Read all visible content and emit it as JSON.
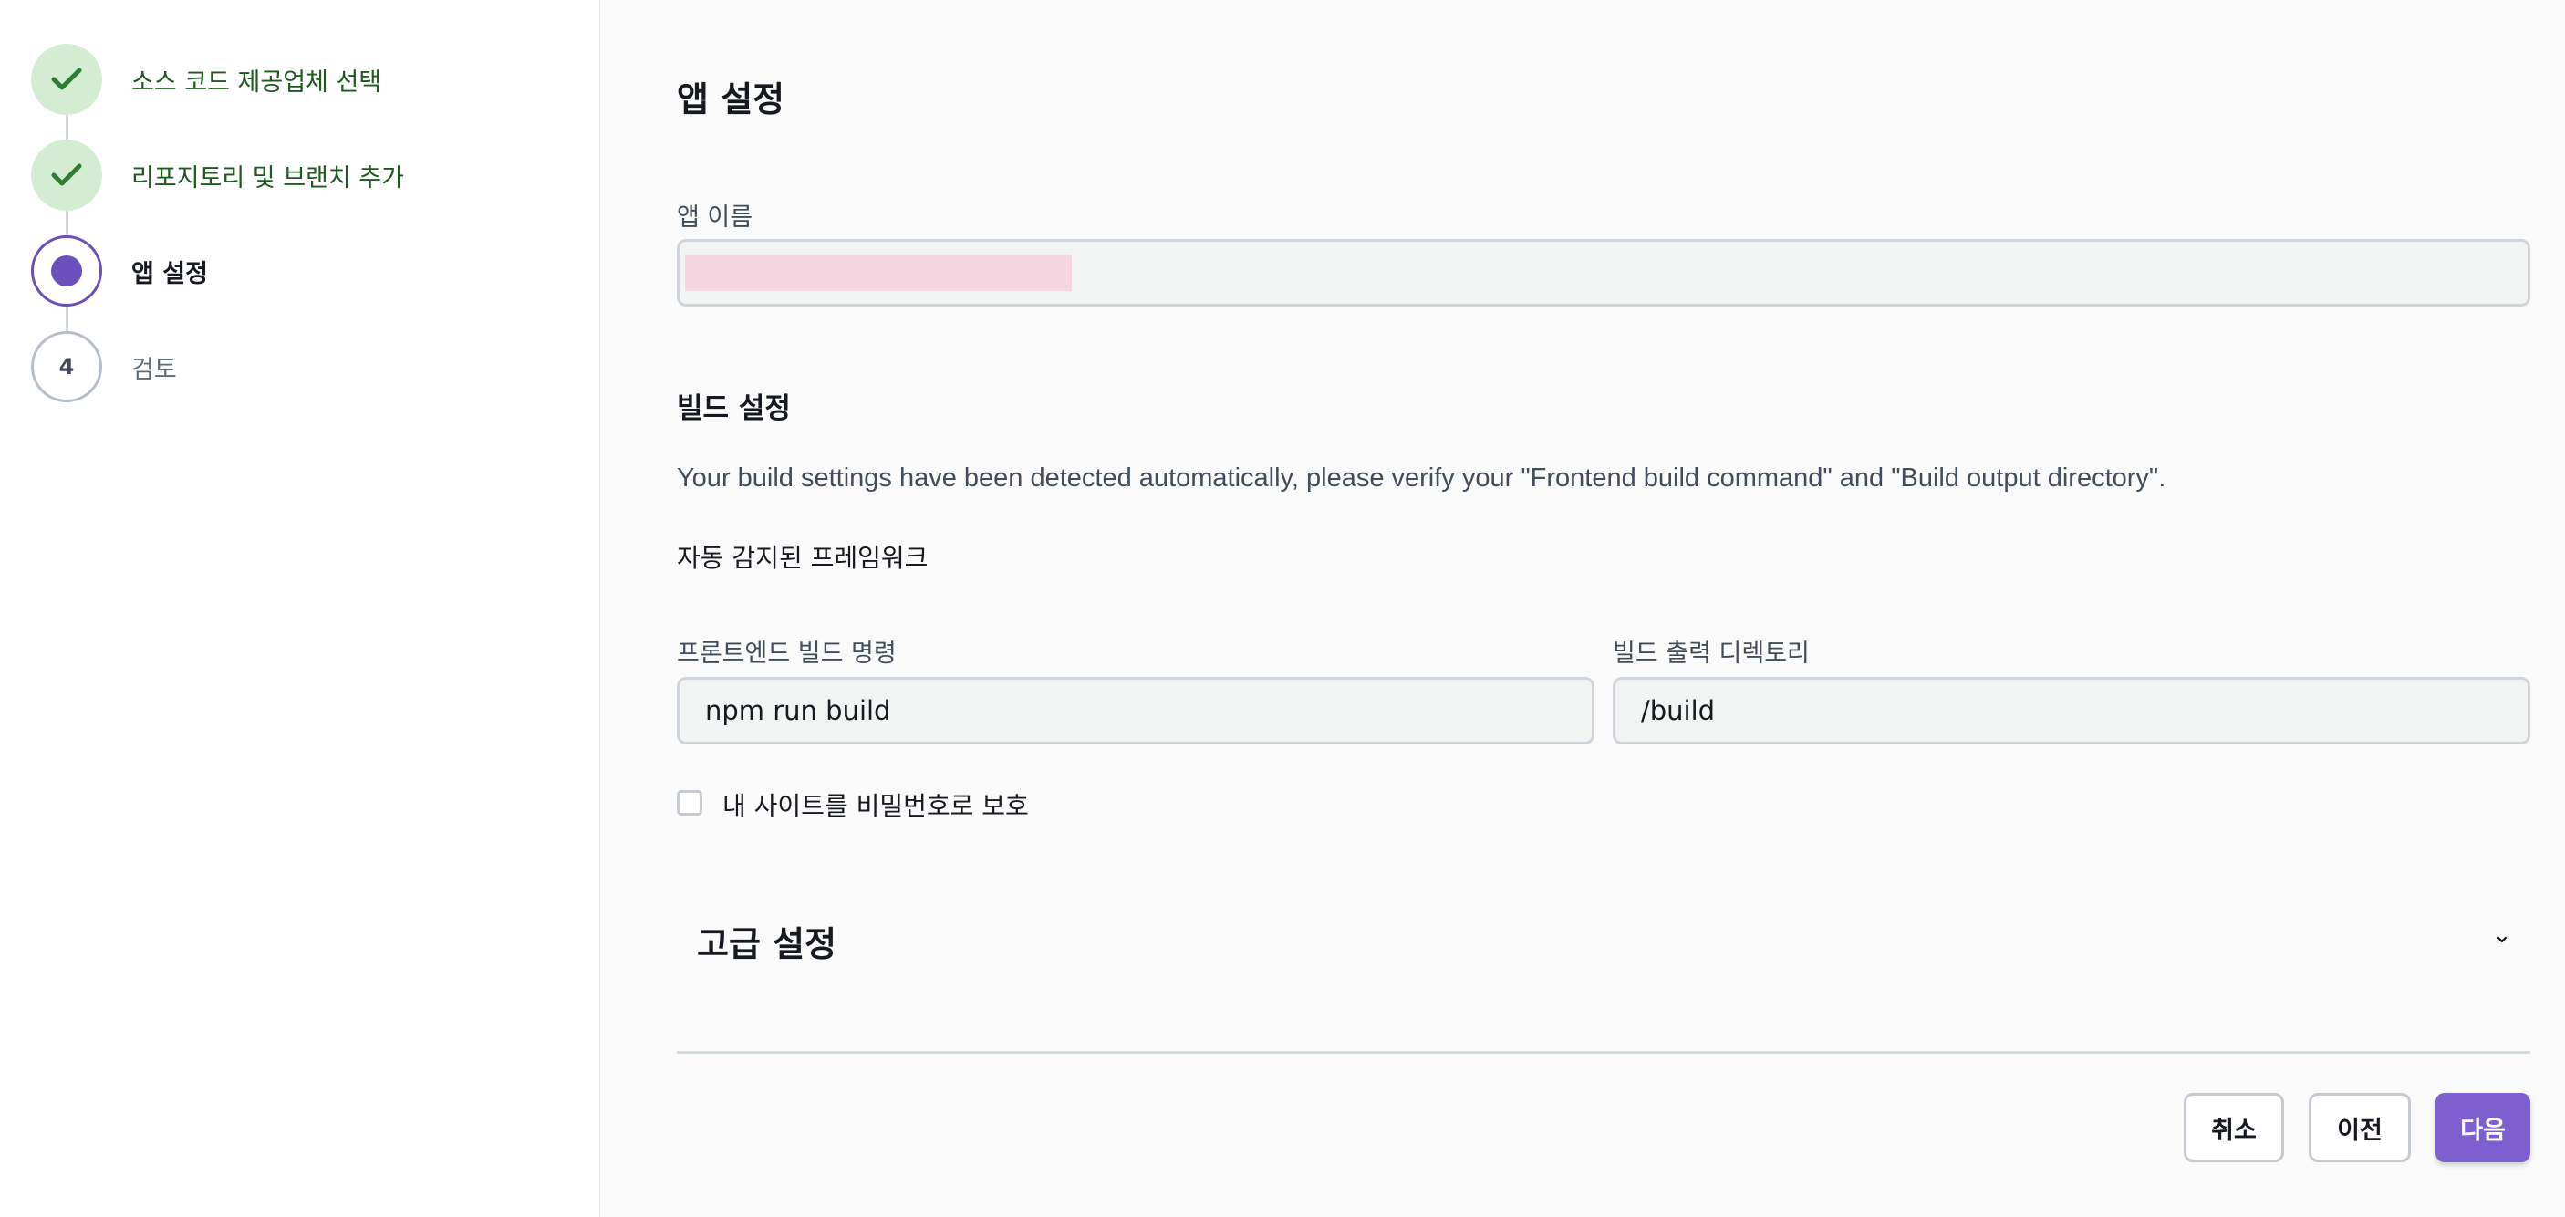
{
  "steps": [
    {
      "label": "소스 코드 제공업체 선택",
      "state": "done"
    },
    {
      "label": "리포지토리 및 브랜치 추가",
      "state": "done"
    },
    {
      "label": "앱 설정",
      "state": "current"
    },
    {
      "label": "검토",
      "state": "pending",
      "number": "4"
    }
  ],
  "main": {
    "title": "앱 설정",
    "app_name_label": "앱 이름",
    "app_name_value": "",
    "build_settings_title": "빌드 설정",
    "build_settings_desc": "Your build settings have been detected automatically, please verify your \"Frontend build command\" and \"Build output directory\".",
    "framework_label": "자동 감지된 프레임워크",
    "build_command_label": "프론트엔드 빌드 명령",
    "build_command_value": "npm run build",
    "output_dir_label": "빌드 출력 디렉토리",
    "output_dir_value": "/build",
    "password_protect_label": "내 사이트를 비밀번호로 보호",
    "advanced_title": "고급 설정"
  },
  "buttons": {
    "cancel": "취소",
    "previous": "이전",
    "next": "다음"
  },
  "colors": {
    "accent": "#7d5fd0",
    "done_bg": "#d4ecd2",
    "done_check": "#2e7d32"
  }
}
